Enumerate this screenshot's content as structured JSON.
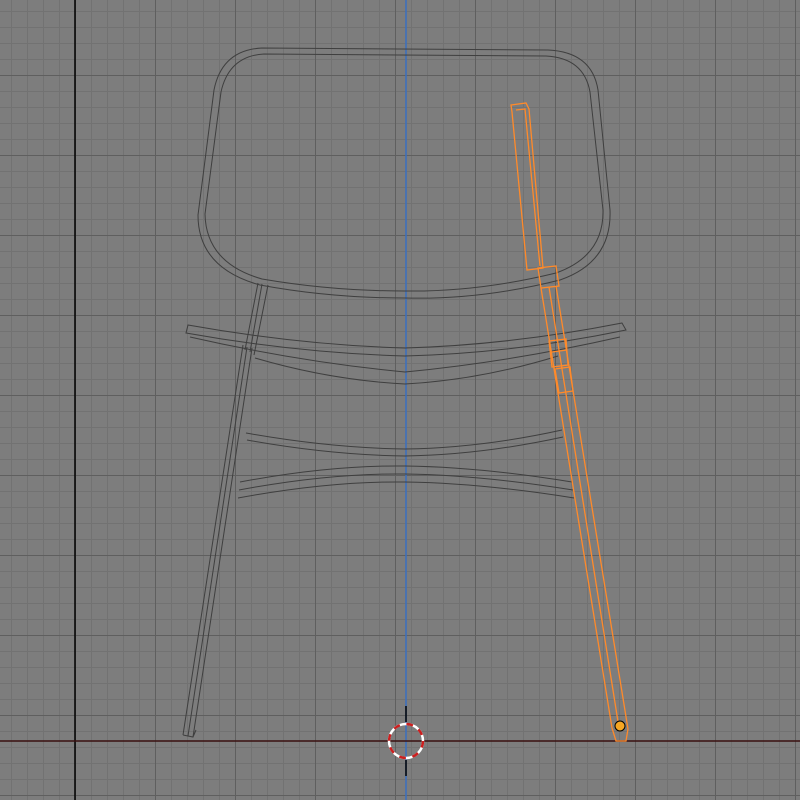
{
  "viewport": {
    "background_color": "#7d7d7d",
    "minor_grid_color": "#727272",
    "major_grid_color": "#5f5f5f"
  },
  "axes": {
    "x_axis_color": "#3a1010",
    "y_axis_color": "#3a6fc0",
    "black_axis_color": "#000000"
  },
  "model": {
    "wire_color": "#3f3f3f",
    "selection_color": "#ff8a2a",
    "selected_part": "chair-leg"
  },
  "cursor_3d": {
    "icon": "3d-cursor-icon",
    "ring_color_1": "#cc1f1f",
    "ring_color_2": "#ffffff"
  },
  "origin_dot": {
    "icon": "object-origin-icon",
    "color": "#f5a623"
  }
}
